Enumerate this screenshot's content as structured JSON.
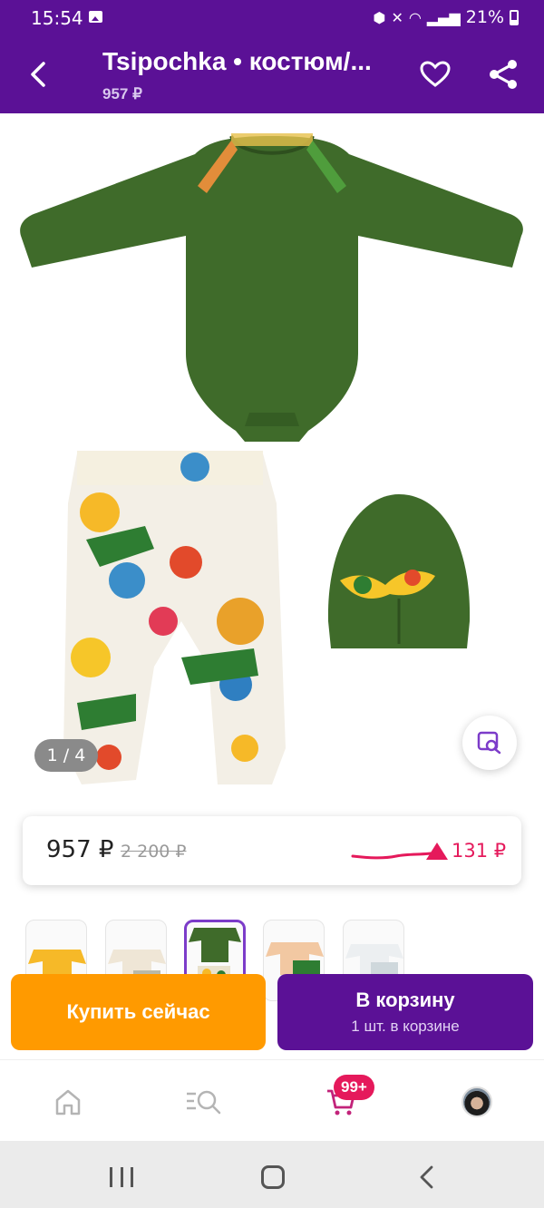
{
  "status_bar": {
    "time": "15:54",
    "battery": "21%"
  },
  "header": {
    "title": "Tsipochka • костюм/...",
    "subtitle": "957 ₽"
  },
  "gallery": {
    "counter": "1 / 4",
    "image_count": 4,
    "current": 1
  },
  "price": {
    "current": "957 ₽",
    "old": "2 200 ₽",
    "trend_value": "131 ₽"
  },
  "thumbnails": {
    "count": 5,
    "active_index": 2
  },
  "actions": {
    "buy_now": "Купить сейчас",
    "to_cart": "В корзину",
    "to_cart_sub": "1 шт. в корзине"
  },
  "bottom_nav": {
    "cart_badge": "99+"
  },
  "colors": {
    "brand_purple": "#5b1196",
    "accent_orange": "#ff9a00",
    "accent_pink": "#e5195b",
    "garment_green": "#3f6b2a"
  }
}
